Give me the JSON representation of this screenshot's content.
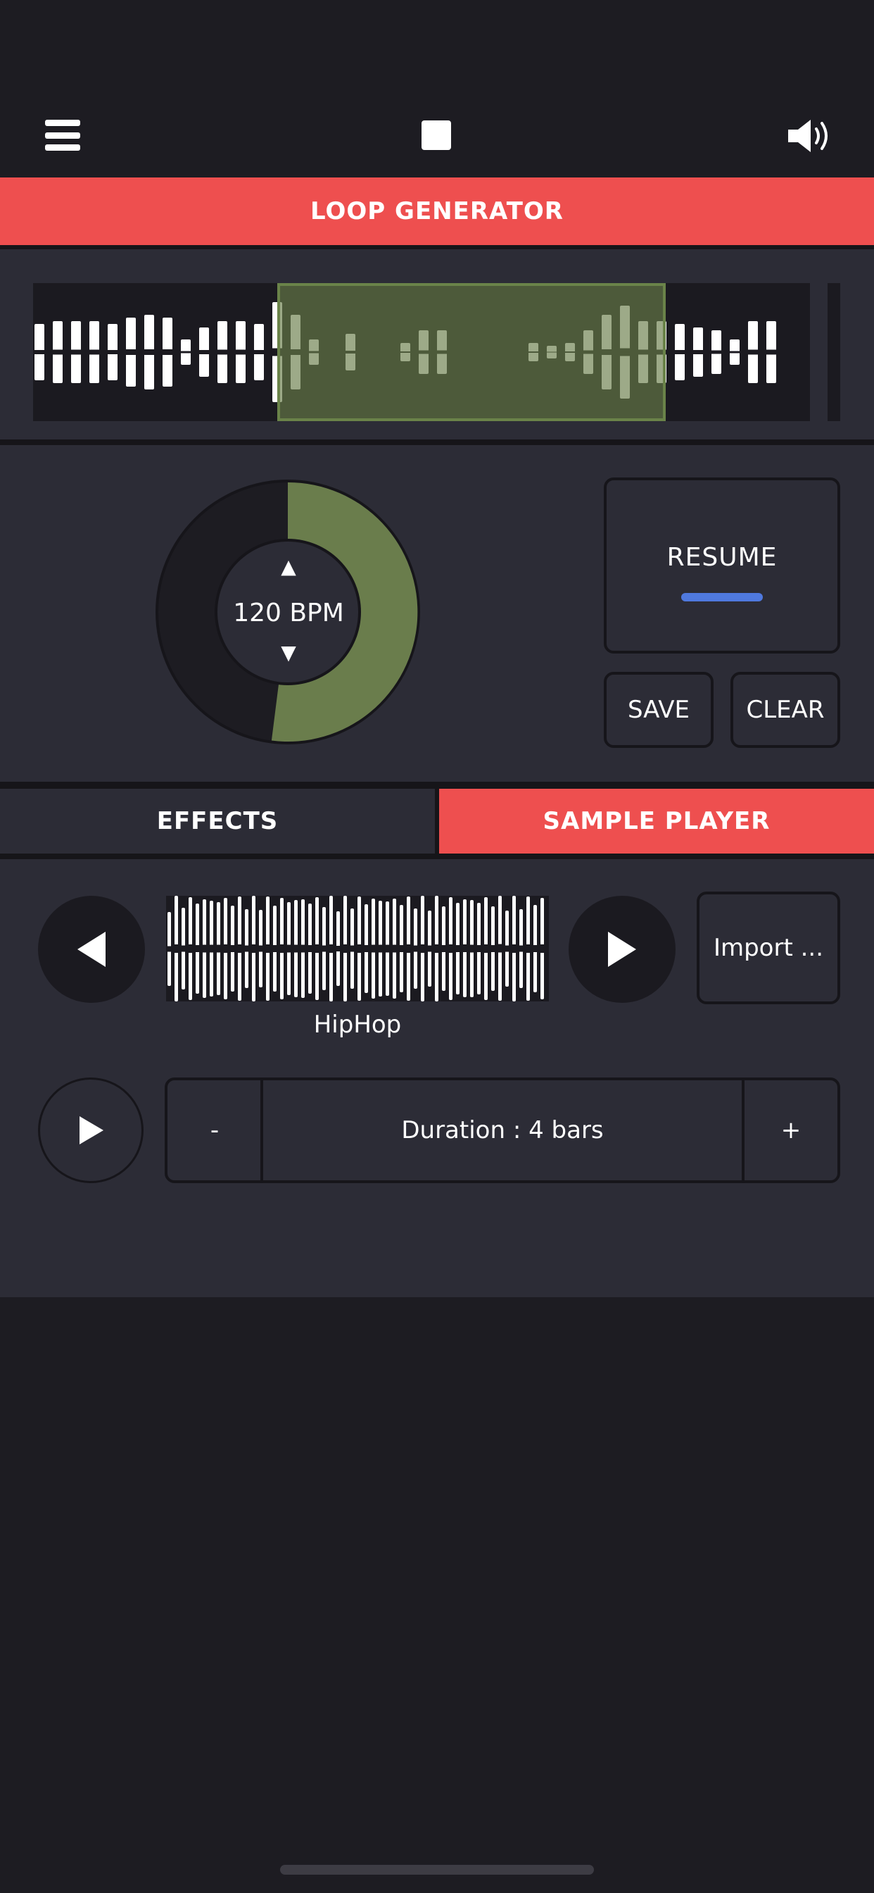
{
  "header": {
    "title": "LOOP GENERATOR",
    "icons": {
      "menu": "menu-icon",
      "stop": "stop-icon",
      "sound": "speaker-icon"
    }
  },
  "tempo": {
    "bpm_label": "120 BPM",
    "up_glyph": "▲",
    "down_glyph": "▼",
    "dial_fill_fraction": 0.52
  },
  "controls": {
    "resume_label": "RESUME",
    "save_label": "SAVE",
    "clear_label": "CLEAR"
  },
  "tabs": [
    {
      "label": "EFFECTS",
      "active": false
    },
    {
      "label": "SAMPLE PLAYER",
      "active": true
    }
  ],
  "sample_player": {
    "sample_name": "HipHop",
    "import_label": "Import ...",
    "duration_label": "Duration : 4 bars",
    "minus_label": "-",
    "plus_label": "+"
  },
  "colors": {
    "accent_red": "#ee4f4f",
    "panel": "#2c2c36",
    "background": "#1d1c22",
    "dial_green": "#6a7d4c",
    "resume_indicator": "#4f79de"
  }
}
